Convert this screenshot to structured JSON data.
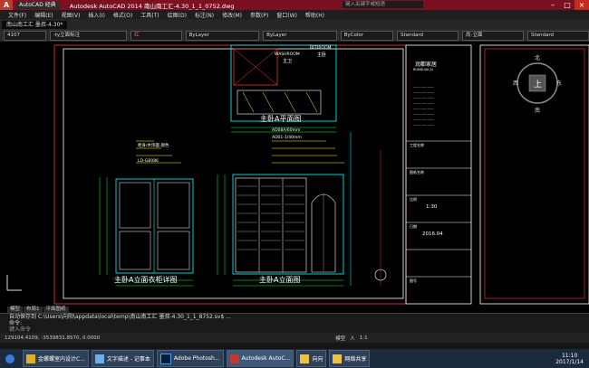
{
  "titlebar": {
    "app_letter": "A",
    "workspace": "AutoCAD 经典",
    "title": "Autodesk AutoCAD 2014    南山南工汇-4.30_1_1_0752.dwg",
    "help_placeholder": "键入关键字或短语"
  },
  "menu": [
    "文件(F)",
    "编辑(E)",
    "视图(V)",
    "插入(I)",
    "格式(O)",
    "工具(T)",
    "绘图(D)",
    "标注(N)",
    "修改(M)",
    "参数(P)",
    "窗口(W)",
    "帮助(H)"
  ],
  "file_tabs": [
    "南山南工汇  墨叔-4.30*"
  ],
  "toolbar": {
    "items": [
      "4107",
      "-ty立面标注",
      "红",
      "ByLayer",
      "ByLayer",
      "ByColor",
      "Standard",
      "尚-立面",
      "Standard"
    ]
  },
  "drawing": {
    "labels": {
      "plan_view": "主卧A平面图",
      "wardrobe_view": "主卧A立面衣柜详图",
      "elevation_view": "主卧A立面图",
      "bedroom": "BEDROOM",
      "bedroom_cn": "主卧",
      "washroom": "WASHROOM",
      "washroom_cn": "主卫",
      "company": "润都家居",
      "company_en": "RUNDUJIA JU",
      "scale": "1:30",
      "date": "2016.04",
      "note1": "AD08A/60mm",
      "note2": "AD01-1/40mm",
      "note3": "柜身/木饰面 颜色",
      "note4": "LD-GB086"
    },
    "title_block": {
      "proj_label": "工程名称",
      "drawing_label": "图纸名称",
      "scale_label": "比例",
      "date_label": "日期",
      "number_label": "图号"
    }
  },
  "layout_tabs": [
    "模型",
    "布局1",
    "平面图纸"
  ],
  "command": {
    "line1": "自动保存到 C:\\Users\\向阳\\appdata\\local\\temp\\南山南工汇 墨叔-4.30_1_1_8752.sv$ ...",
    "line2": "命令:",
    "prompt": "键入命令"
  },
  "status": {
    "coords": "129104.4109, -3539831.8570, 0.0000",
    "scale": "1:1",
    "modes": [
      "模型",
      "人"
    ]
  },
  "taskbar": {
    "items": [
      "金螺螺室内设计C...",
      "文字描述 - 记事本",
      "Adobe Photosh...",
      "Autodesk AutoC...",
      "向向",
      "网络共享"
    ],
    "time": "11:10",
    "date": "2017/1/14"
  },
  "colors": {
    "accent_title": "#7a1020",
    "cad_cyan": "#00ffff",
    "cad_white": "#ffffff",
    "cad_yellow": "#ffff00",
    "cad_red": "#ff3b3b",
    "cad_green": "#00ff3c"
  },
  "icons": [
    "autocad-logo-icon",
    "minimize-icon",
    "maximize-icon",
    "close-icon",
    "compass-icon",
    "start-icon"
  ]
}
